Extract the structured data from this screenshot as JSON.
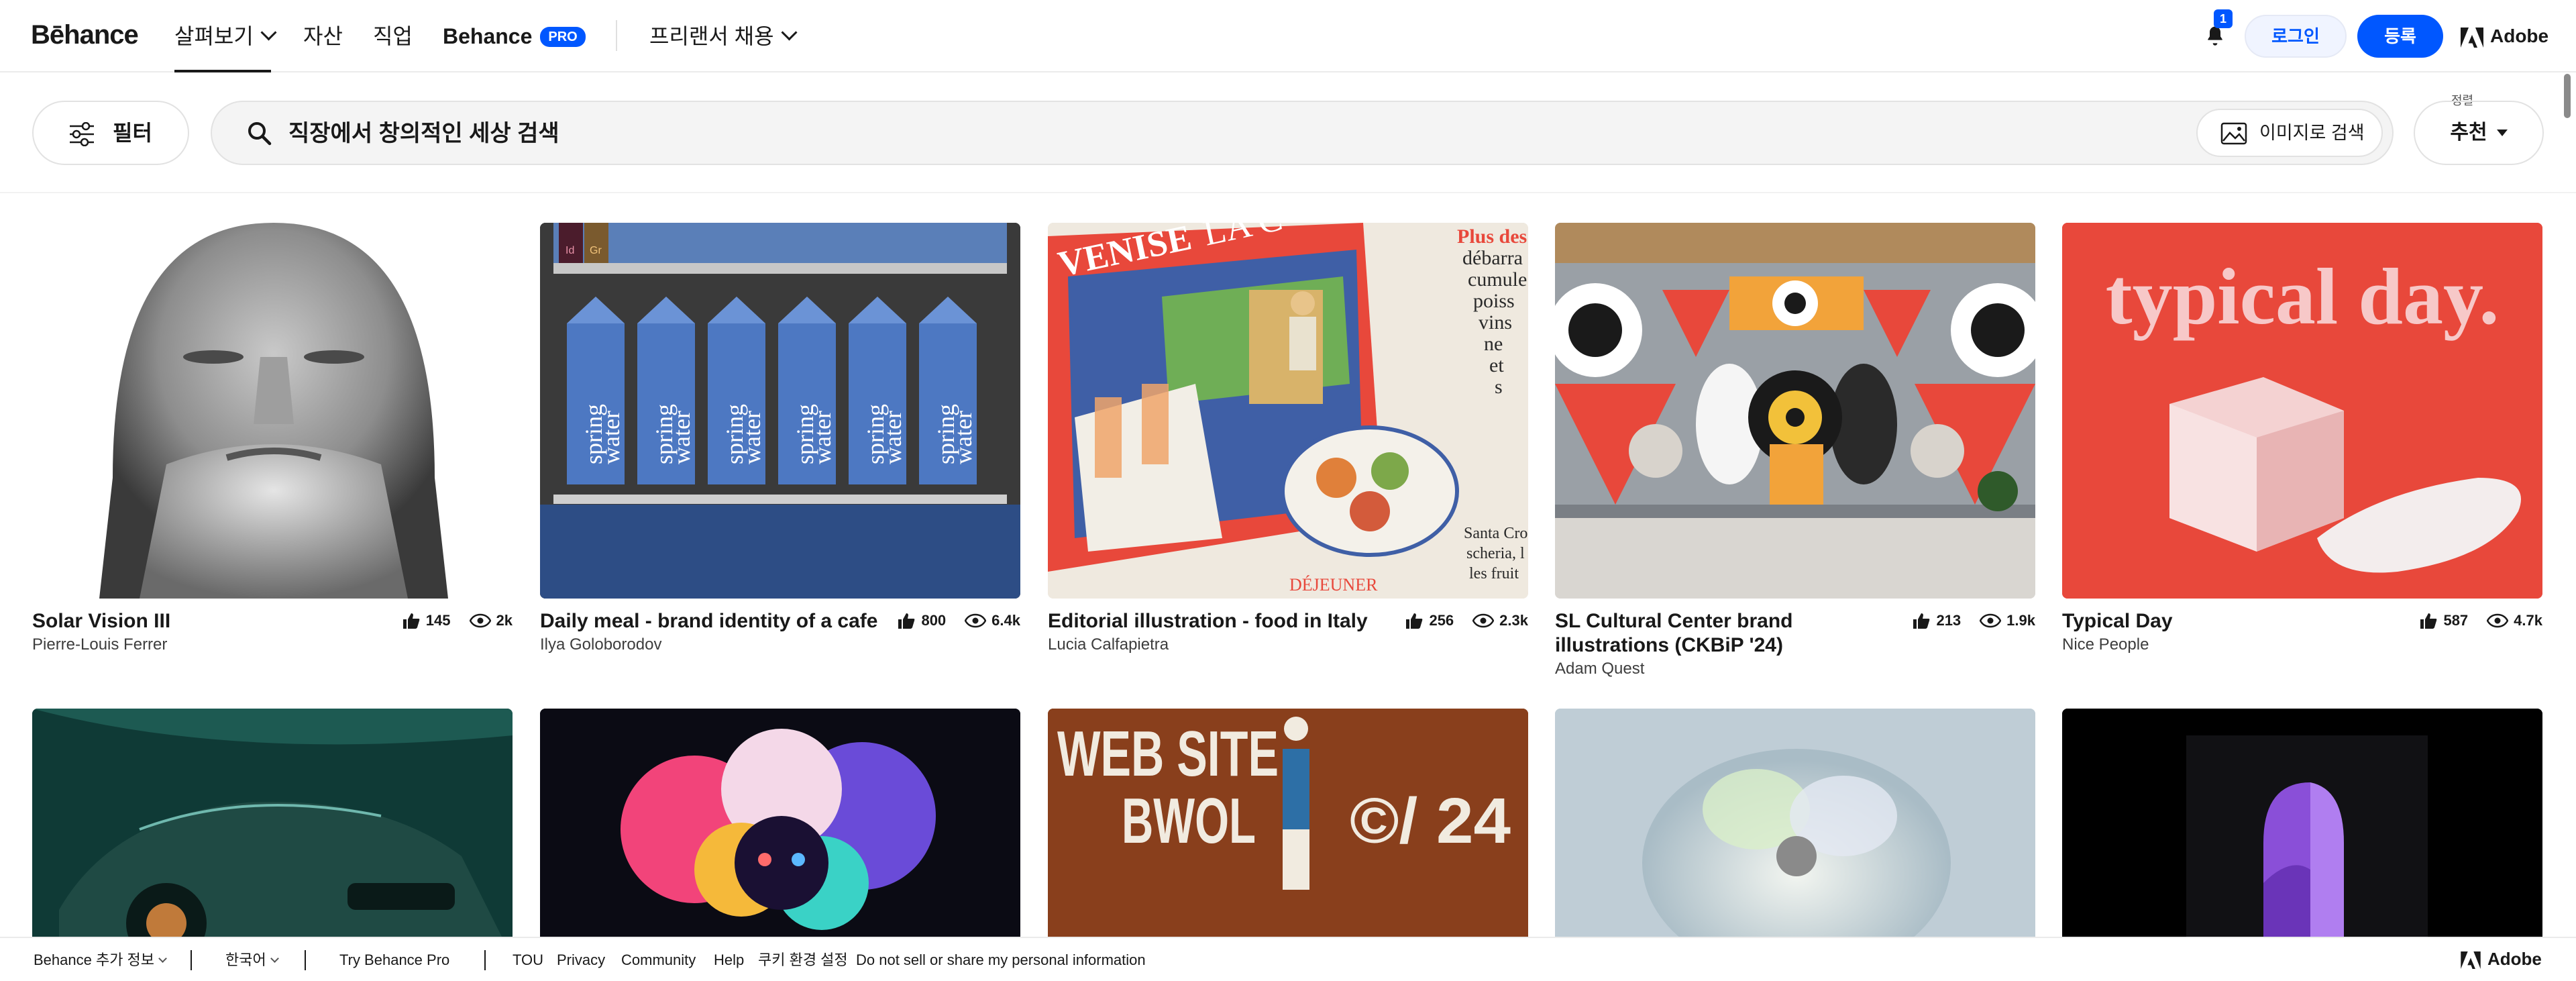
{
  "nav": {
    "logo": "Bēhance",
    "explore": "살펴보기",
    "assets": "자산",
    "jobs": "직업",
    "behance_pro": "Behance",
    "pro_badge": "PRO",
    "hire_freelancers": "프리랜서 채용",
    "notification_count": "1",
    "login": "로그인",
    "signup": "등록",
    "adobe": "Adobe"
  },
  "filters": {
    "filter_label": "필터",
    "search_placeholder": "직장에서 창의적인 세상 검색",
    "image_search": "이미지로 검색",
    "sort_label": "정렬",
    "sort_value": "추천"
  },
  "projects": [
    {
      "title": "Solar Vision III",
      "owner": "Pierre-Louis Ferrer",
      "likes": "145",
      "views": "2k"
    },
    {
      "title": "Daily meal - brand identity of a cafe",
      "owner": "Ilya Goloborodov",
      "likes": "800",
      "views": "6.4k"
    },
    {
      "title": "Editorial illustration - food in Italy",
      "owner": "Lucia Calfapietra",
      "likes": "256",
      "views": "2.3k"
    },
    {
      "title": "SL Cultural Center brand illustrations (CKBiP '24)",
      "owner": "Adam Quest",
      "likes": "213",
      "views": "1.9k"
    },
    {
      "title": "Typical Day",
      "owner": "Nice People",
      "likes": "587",
      "views": "4.7k"
    }
  ],
  "thumb_text": {
    "spring": "spring",
    "water": "water",
    "badge_id": "Id",
    "badge_gr": "Gr",
    "venise": "VENISE",
    "la_c": "LA C",
    "plus_des": "Plus des",
    "debarra": "débarra",
    "cumule": "cumule",
    "poiss": "poiss",
    "vins": "vins",
    "ne": "ne",
    "et": "et",
    "s": "s",
    "santa_cro": "Santa Cro",
    "scheria": "scheria, l",
    "les_fruits": "les fruit",
    "dejeuner": "DÉJEUNER",
    "typical_day": "typical day.",
    "web_site": "WEB SITE",
    "bwol": "BWOL",
    "c24": "©/ 24"
  },
  "footer": {
    "more_behance": "Behance 추가 정보",
    "language": "한국어",
    "try_pro": "Try Behance Pro",
    "tou": "TOU",
    "privacy": "Privacy",
    "community": "Community",
    "help": "Help",
    "cookie": "쿠키 환경 설정",
    "do_not_sell": "Do not sell or share my personal information",
    "adobe": "Adobe"
  },
  "colors": {
    "brand_blue": "#0057ff",
    "text": "#191919",
    "typical_day_red": "#e8483b"
  }
}
